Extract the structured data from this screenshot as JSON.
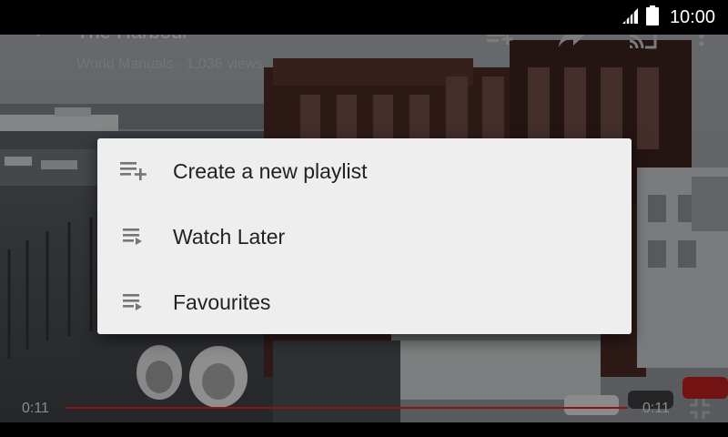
{
  "status_bar": {
    "time": "10:00",
    "icons": [
      "signal-icon",
      "battery-icon"
    ]
  },
  "video": {
    "title": "The Harbour",
    "meta": "World Manuals · 1,036 views",
    "elapsed": "0:11",
    "duration": "0:11",
    "progress": 1.0,
    "actions": [
      "add-to-playlist-icon",
      "share-icon",
      "cast-icon",
      "overflow-menu-icon"
    ]
  },
  "dialog": {
    "items": [
      {
        "label": "Create a new playlist",
        "icon": "playlist-add-icon"
      },
      {
        "label": "Watch Later",
        "icon": "playlist-play-icon"
      },
      {
        "label": "Favourites",
        "icon": "playlist-play-icon"
      }
    ]
  },
  "colors": {
    "dialog_bg": "#eeeeee",
    "dialog_text": "#212121",
    "icon_gray": "#757575",
    "progress_red": "#8e1313",
    "overlay_text": "#8e8e8e"
  }
}
